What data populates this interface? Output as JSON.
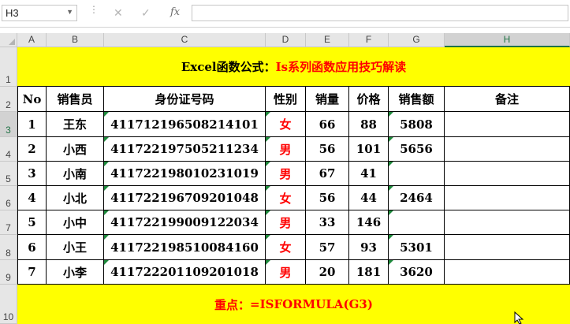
{
  "formula_bar": {
    "name_box": "H3",
    "cancel_icon": "✕",
    "enter_icon": "✓",
    "fx_label": "fx"
  },
  "columns": [
    "A",
    "B",
    "C",
    "D",
    "E",
    "F",
    "G",
    "H"
  ],
  "rows": [
    "1",
    "2",
    "3",
    "4",
    "5",
    "6",
    "7",
    "8",
    "9",
    "10"
  ],
  "title": {
    "part1": "Excel函数公式：",
    "part2": "Is系列函数应用技巧解读"
  },
  "headers": [
    "No",
    "销售员",
    "身份证号码",
    "性别",
    "销量",
    "价格",
    "销售额",
    "备注"
  ],
  "records": [
    {
      "no": "1",
      "name": "王东",
      "id": "41171219650821410​1",
      "gender": "女",
      "qty": "66",
      "price": "88",
      "sales": "5808",
      "note": ""
    },
    {
      "no": "2",
      "name": "小西",
      "id": "411722197505211234",
      "gender": "男",
      "qty": "56",
      "price": "101",
      "sales": "5656",
      "note": ""
    },
    {
      "no": "3",
      "name": "小南",
      "id": "411722198010231019",
      "gender": "男",
      "qty": "67",
      "price": "41",
      "sales": "",
      "note": ""
    },
    {
      "no": "4",
      "name": "小北",
      "id": "411722196709201048",
      "gender": "女",
      "qty": "56",
      "price": "44",
      "sales": "2464",
      "note": ""
    },
    {
      "no": "5",
      "name": "小中",
      "id": "411722199009122034",
      "gender": "男",
      "qty": "33",
      "price": "146",
      "sales": "",
      "note": ""
    },
    {
      "no": "6",
      "name": "小王",
      "id": "411722198510084160",
      "gender": "女",
      "qty": "57",
      "price": "93",
      "sales": "5301",
      "note": ""
    },
    {
      "no": "7",
      "name": "小李",
      "id": "411722201109201018",
      "gender": "男",
      "qty": "20",
      "price": "181",
      "sales": "3620",
      "note": ""
    }
  ],
  "footer": {
    "label": "重点：",
    "formula": "=ISFORMULA(G3)"
  }
}
